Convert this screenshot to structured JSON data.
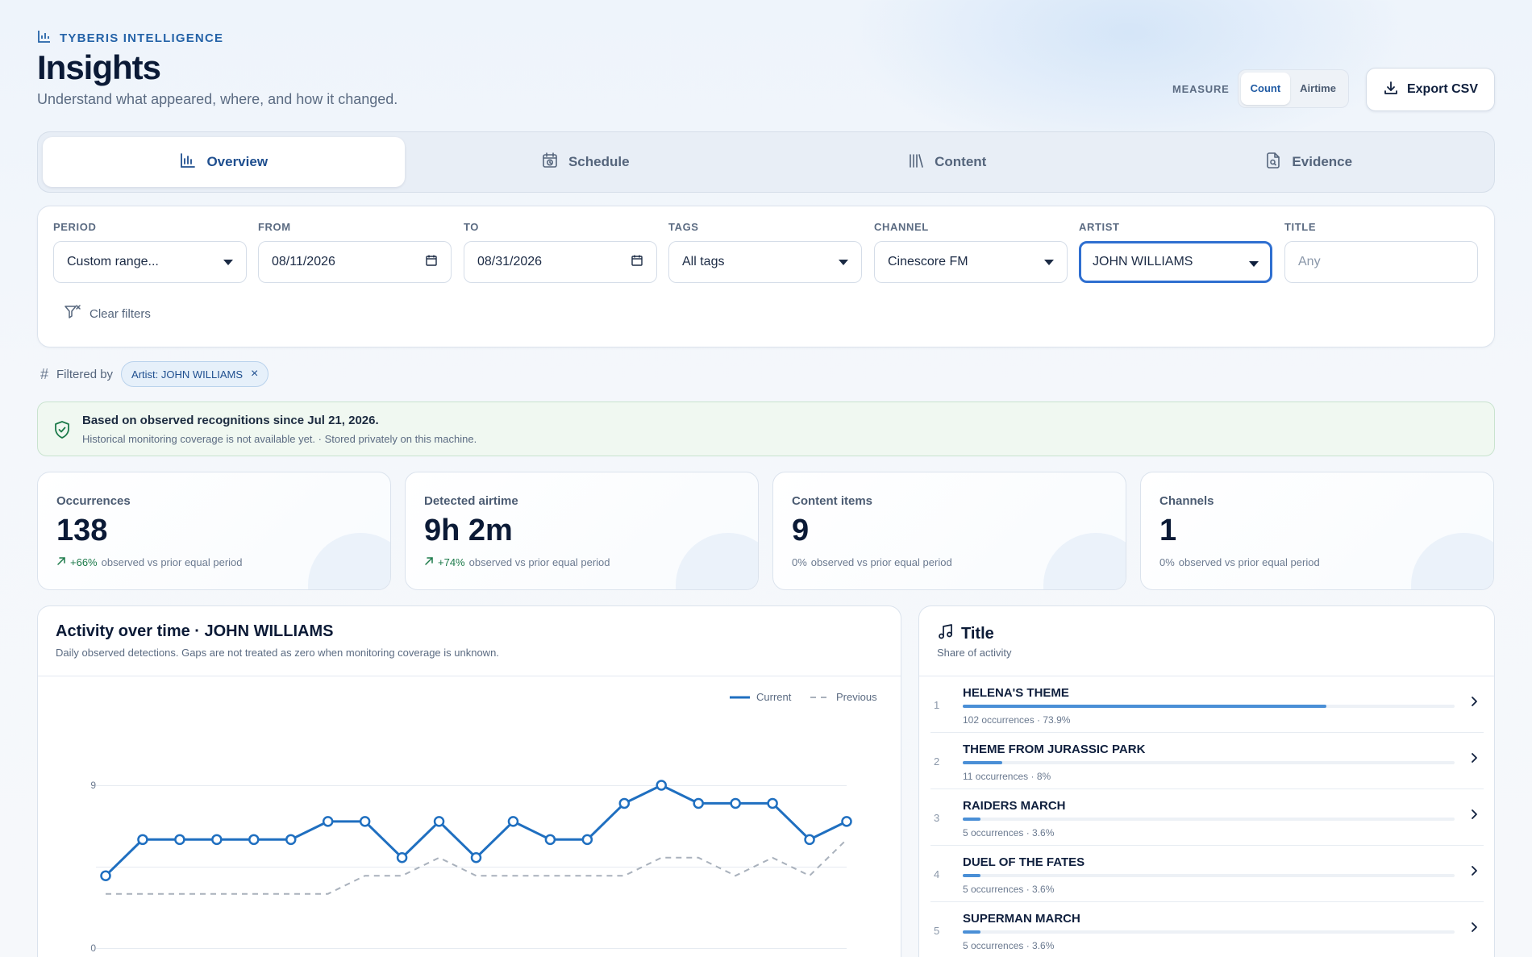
{
  "header": {
    "brand": "TYBERIS INTELLIGENCE",
    "title": "Insights",
    "subtitle": "Understand what appeared, where, and how it changed.",
    "measure_label": "MEASURE",
    "measure_options": [
      "Count",
      "Airtime"
    ],
    "measure_selected": "Count",
    "export_label": "Export CSV"
  },
  "tabs": [
    {
      "label": "Overview",
      "icon": "bar-chart-icon",
      "active": true
    },
    {
      "label": "Schedule",
      "icon": "calendar-clock-icon",
      "active": false
    },
    {
      "label": "Content",
      "icon": "library-icon",
      "active": false
    },
    {
      "label": "Evidence",
      "icon": "file-search-icon",
      "active": false
    }
  ],
  "filters": {
    "period": {
      "label": "PERIOD",
      "value": "Custom range..."
    },
    "from": {
      "label": "FROM",
      "value": "08/11/2026"
    },
    "to": {
      "label": "TO",
      "value": "08/31/2026"
    },
    "tags": {
      "label": "TAGS",
      "value": "All tags"
    },
    "channel": {
      "label": "CHANNEL",
      "value": "Cinescore FM"
    },
    "artist": {
      "label": "ARTIST",
      "value": "JOHN WILLIAMS"
    },
    "title": {
      "label": "TITLE",
      "placeholder": "Any"
    },
    "clear_label": "Clear filters"
  },
  "filtered_by": {
    "label": "Filtered by",
    "chip": "Artist: JOHN WILLIAMS"
  },
  "notice": {
    "title": "Based on observed recognitions since Jul 21, 2026.",
    "subtitle": "Historical monitoring coverage is not available yet. · Stored privately on this machine."
  },
  "kpis": [
    {
      "label": "Occurrences",
      "value": "138",
      "delta": "+66%",
      "delta_text": "observed vs prior equal period",
      "positive": true
    },
    {
      "label": "Detected airtime",
      "value": "9h 2m",
      "delta": "+74%",
      "delta_text": "observed vs prior equal period",
      "positive": true
    },
    {
      "label": "Content items",
      "value": "9",
      "delta": "0%",
      "delta_text": "observed vs prior equal period",
      "positive": false
    },
    {
      "label": "Channels",
      "value": "1",
      "delta": "0%",
      "delta_text": "observed vs prior equal period",
      "positive": false
    }
  ],
  "activity": {
    "title": "Activity over time · JOHN WILLIAMS",
    "subtitle": "Daily observed detections. Gaps are not treated as zero when monitoring coverage is unknown."
  },
  "chart_data": {
    "type": "line",
    "title": "Activity over time · JOHN WILLIAMS",
    "xlabel": "",
    "ylabel": "",
    "ylim": [
      0,
      9
    ],
    "y_ticks": [
      0,
      9
    ],
    "grid": true,
    "legend_position": "top-right",
    "x": [
      1,
      2,
      3,
      4,
      5,
      6,
      7,
      8,
      9,
      10,
      11,
      12,
      13,
      14,
      15,
      16,
      17,
      18,
      19,
      20,
      21
    ],
    "series": [
      {
        "name": "Current",
        "style": "solid",
        "color": "#1f6fc0",
        "values": [
          4,
          6,
          6,
          6,
          6,
          6,
          7,
          7,
          5,
          7,
          5,
          7,
          6,
          6,
          8,
          9,
          8,
          8,
          8,
          6,
          7
        ]
      },
      {
        "name": "Previous",
        "style": "dashed",
        "color": "#a9b1bc",
        "values": [
          3,
          3,
          3,
          3,
          3,
          3,
          3,
          4,
          4,
          5,
          4,
          4,
          4,
          4,
          4,
          5,
          5,
          4,
          5,
          4,
          6
        ]
      }
    ]
  },
  "titles_panel": {
    "title": "Title",
    "subtitle": "Share of activity",
    "rows": [
      {
        "rank": "1",
        "name": "HELENA'S THEME",
        "meta": "102 occurrences · 73.9%",
        "share": 0.739
      },
      {
        "rank": "2",
        "name": "THEME FROM JURASSIC PARK",
        "meta": "11 occurrences · 8%",
        "share": 0.08
      },
      {
        "rank": "3",
        "name": "RAIDERS MARCH",
        "meta": "5 occurrences · 3.6%",
        "share": 0.036
      },
      {
        "rank": "4",
        "name": "DUEL OF THE FATES",
        "meta": "5 occurrences · 3.6%",
        "share": 0.036
      },
      {
        "rank": "5",
        "name": "SUPERMAN MARCH",
        "meta": "5 occurrences · 3.6%",
        "share": 0.036
      }
    ]
  }
}
